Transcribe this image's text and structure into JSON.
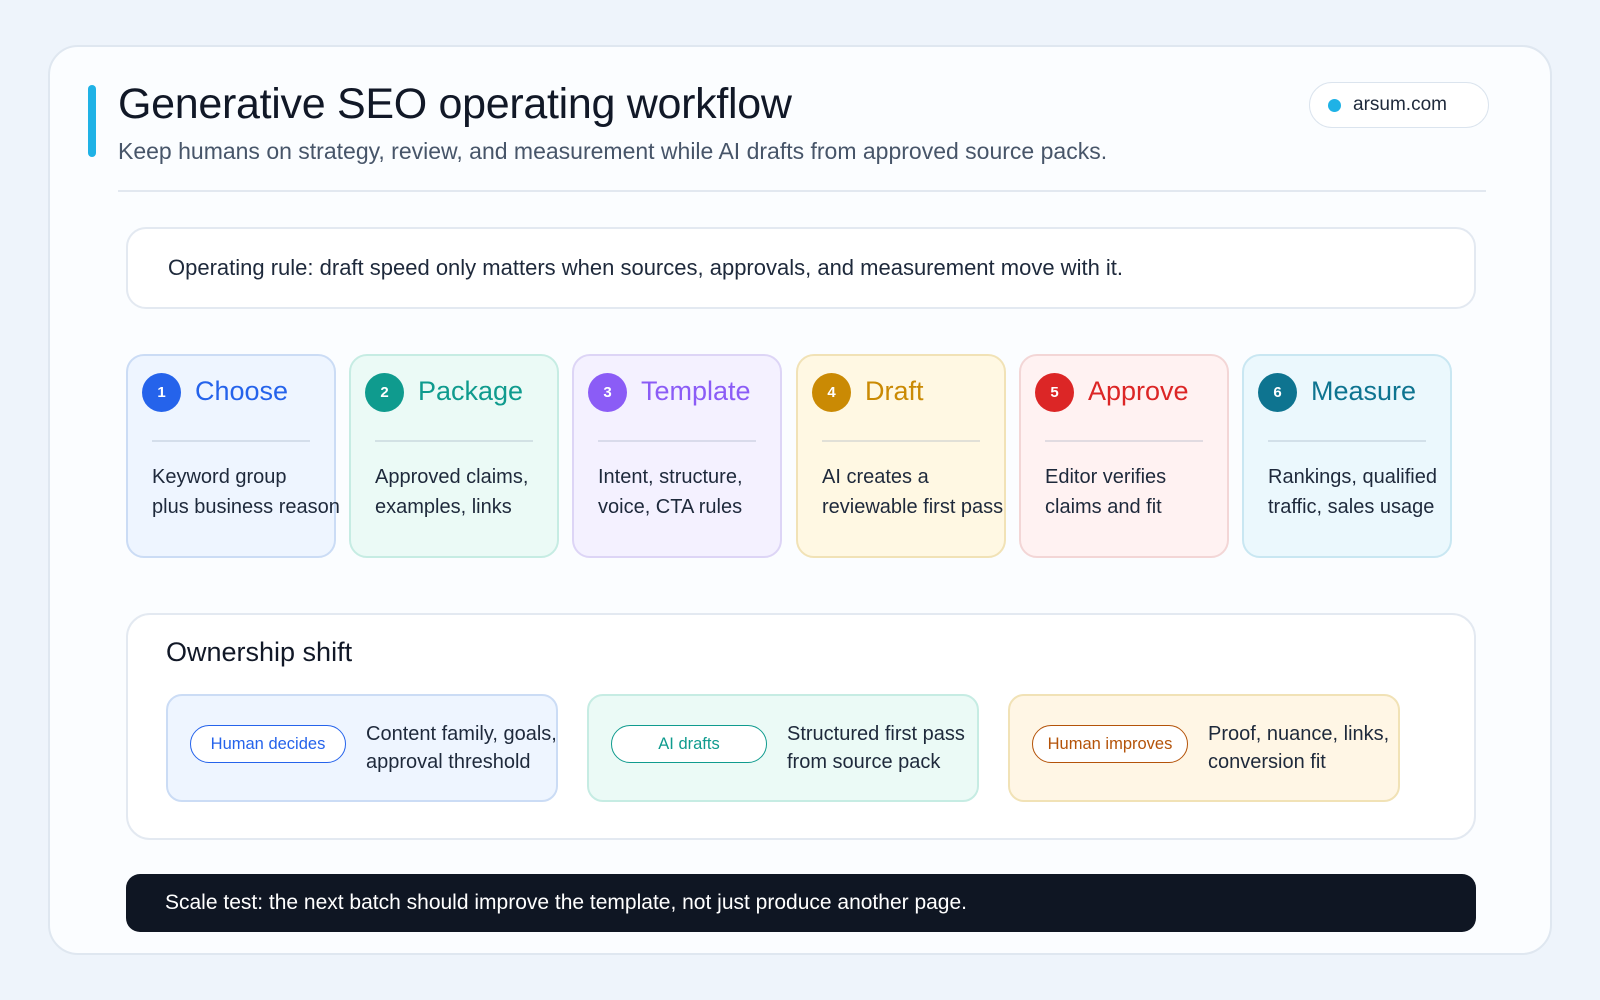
{
  "header": {
    "title": "Generative SEO operating workflow",
    "subtitle": "Keep humans on strategy, review, and measurement while AI drafts from approved source packs.",
    "domain_label": "arsum.com",
    "accent_color": "#1fb2e6"
  },
  "operating_rule": "Operating rule: draft speed only matters when sources, approvals, and measurement move with it.",
  "steps": [
    {
      "number": "1",
      "title": "Choose",
      "description": "Keyword group\nplus business reason",
      "color": "#2563eb",
      "bg": "#eef5ff",
      "border": "#cbdcf5"
    },
    {
      "number": "2",
      "title": "Package",
      "description": "Approved claims,\nexamples, links",
      "color": "#0f9b8e",
      "bg": "#ebfaf6",
      "border": "#c6ece3"
    },
    {
      "number": "3",
      "title": "Template",
      "description": "Intent, structure,\nvoice, CTA rules",
      "color": "#8b5cf6",
      "bg": "#f4f1ff",
      "border": "#ddd5f6"
    },
    {
      "number": "4",
      "title": "Draft",
      "description": "AI creates a\nreviewable first pass",
      "color": "#ca8a04",
      "bg": "#fff8e3",
      "border": "#f1e2b6"
    },
    {
      "number": "5",
      "title": "Approve",
      "description": "Editor verifies\nclaims and fit",
      "color": "#dc2626",
      "bg": "#fff2f2",
      "border": "#f3d6d6"
    },
    {
      "number": "6",
      "title": "Measure",
      "description": "Rankings, qualified\ntraffic, sales usage",
      "color": "#0e7490",
      "bg": "#ebf8fd",
      "border": "#c9e7f2"
    }
  ],
  "ownership": {
    "title": "Ownership shift",
    "items": [
      {
        "badge": "Human decides",
        "text": "Content family, goals,\napproval threshold",
        "color": "#2563eb",
        "bg": "#eef5ff",
        "border": "#cbdcf5"
      },
      {
        "badge": "AI drafts",
        "text": "Structured first pass\nfrom source pack",
        "color": "#0f9b8e",
        "bg": "#ebfaf6",
        "border": "#c6ece3"
      },
      {
        "badge": "Human improves",
        "text": "Proof, nuance, links,\nconversion fit",
        "color": "#b45309",
        "bg": "#fff6e5",
        "border": "#f1e2b6"
      }
    ]
  },
  "scale_test": "Scale test: the next batch should improve the template, not just produce another page."
}
